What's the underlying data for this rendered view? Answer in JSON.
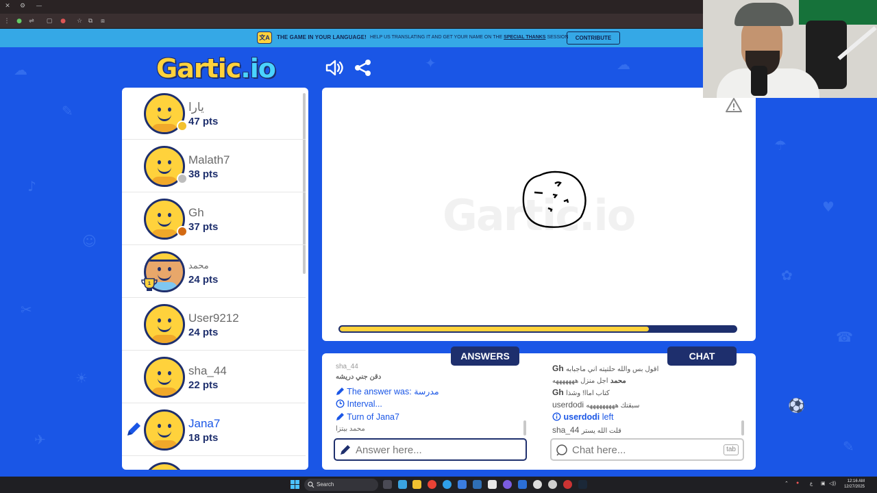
{
  "banner": {
    "icon_text": "文A",
    "headline": "THE GAME IN YOUR LANGUAGE!",
    "help_text": "HELP US TRANSLATING IT AND GET YOUR NAME ON THE",
    "special_thanks": "SPECIAL THANKS",
    "session": "SESSION",
    "contribute_label": "CONTRIBUTE"
  },
  "logo": {
    "text": "Gartic",
    "suffix": ".io"
  },
  "players": [
    {
      "name": "يارا",
      "points": "47 pts",
      "medal": "#f2c12e"
    },
    {
      "name": "Malath7",
      "points": "38 pts",
      "medal": "#bdbdbd"
    },
    {
      "name": "Gh",
      "points": "37 pts",
      "medal": "#d36a12"
    },
    {
      "name": "محمد",
      "points": "24 pts",
      "trophy": "1"
    },
    {
      "name": "User9212",
      "points": "24 pts"
    },
    {
      "name": "sha_44",
      "points": "22 pts"
    },
    {
      "name": "Jana7",
      "points": "18 pts",
      "drawing": true
    }
  ],
  "canvas": {
    "watermark": "Gartic.io",
    "timer_fraction": 0.78
  },
  "answers": {
    "tab_label": "ANSWERS",
    "msg_cut": "sha_44",
    "msg1_user": "دقن جني دريشه",
    "answer_prefix": "The answer was:",
    "answer_word": "مدرسة",
    "interval": "Interval...",
    "turn_prefix": "Turn of",
    "turn_name": "Jana7",
    "msg_last": "محمد بيتزا",
    "placeholder": "Answer here..."
  },
  "chat": {
    "tab_label": "CHAT",
    "m0_text": "اقول بس والله حلتيته اني ماجبابه",
    "m0_user": "Gh",
    "m1_user": "محمد",
    "m1_text": "اجل منزل هههههههه",
    "m2_user": "Gh",
    "m2_text": "كتاب اماا! وشذا",
    "m3_user": "userdodi",
    "m3_text": "سبقتك هههههههههه",
    "left_user": "userdodi",
    "left_text": "left",
    "m4_user": "sha_44",
    "m4_text": "قلت الله يستر",
    "placeholder": "Chat here...",
    "tab_key": "tab"
  },
  "taskbar": {
    "search_label": "Search",
    "lang": "ع",
    "time": "12:16 AM",
    "date": "12/27/2025"
  },
  "colors": {
    "background": "#1a56e6",
    "navy": "#1e2f6d",
    "yellow": "#ffd23c",
    "banner": "#35a8e6"
  }
}
